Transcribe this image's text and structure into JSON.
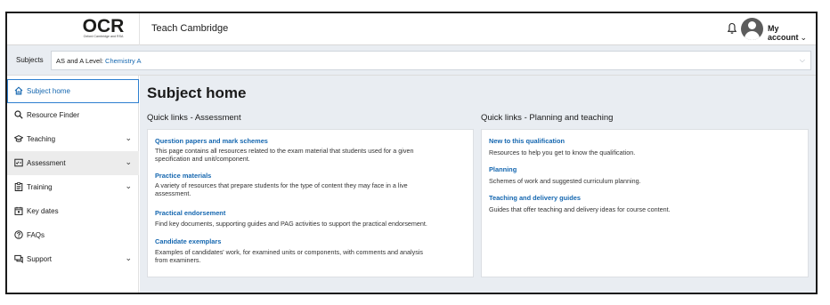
{
  "header": {
    "logo_text": "OCR",
    "logo_subtext": "Oxford Cambridge and RSA",
    "site_title": "Teach Cambridge",
    "account_label": "My account",
    "account_chevron": "⌄"
  },
  "subject_bar": {
    "label": "Subjects",
    "selected_prefix": "AS and A Level: ",
    "selected_value": "Chemistry A"
  },
  "sidebar": {
    "items": [
      {
        "label": "Subject home",
        "icon": "home-icon",
        "active": true
      },
      {
        "label": "Resource Finder",
        "icon": "search-icon"
      },
      {
        "label": "Teaching",
        "icon": "graduation-cap-icon",
        "expandable": true
      },
      {
        "label": "Assessment",
        "icon": "assessment-icon",
        "expandable": true
      },
      {
        "label": "Training",
        "icon": "training-icon",
        "expandable": true
      },
      {
        "label": "Key dates",
        "icon": "calendar-icon"
      },
      {
        "label": "FAQs",
        "icon": "question-icon"
      },
      {
        "label": "Support",
        "icon": "chat-icon",
        "expandable": true
      }
    ]
  },
  "main": {
    "page_title": "Subject home",
    "assessment": {
      "title": "Quick links - Assessment",
      "links": [
        {
          "title": "Question papers and mark schemes",
          "desc_lines": [
            "This page contains all resources related to the exam material that students used for a given",
            "specification and unit/component."
          ]
        },
        {
          "title": "Practice materials",
          "desc_lines": [
            "A variety of resources that prepare students for the type of content they may face in a live",
            "assessment."
          ]
        },
        {
          "title": "Practical endorsement",
          "desc_lines": [
            "Find key documents, supporting guides and PAG activities to support the practical endorsement."
          ]
        },
        {
          "title": "Candidate exemplars",
          "desc_lines": [
            "Examples of candidates' work, for examined units or components, with comments and analysis",
            "from examiners."
          ]
        }
      ]
    },
    "planning": {
      "title": "Quick links - Planning and teaching",
      "links": [
        {
          "title": "New to this qualification",
          "desc_lines": [
            "Resources to help you get to know the qualification."
          ]
        },
        {
          "title": "Planning",
          "desc_lines": [
            "Schemes of work and suggested curriculum planning."
          ]
        },
        {
          "title": "Teaching and delivery guides",
          "desc_lines": [
            "Guides that offer teaching and delivery ideas for course content."
          ]
        }
      ]
    }
  }
}
